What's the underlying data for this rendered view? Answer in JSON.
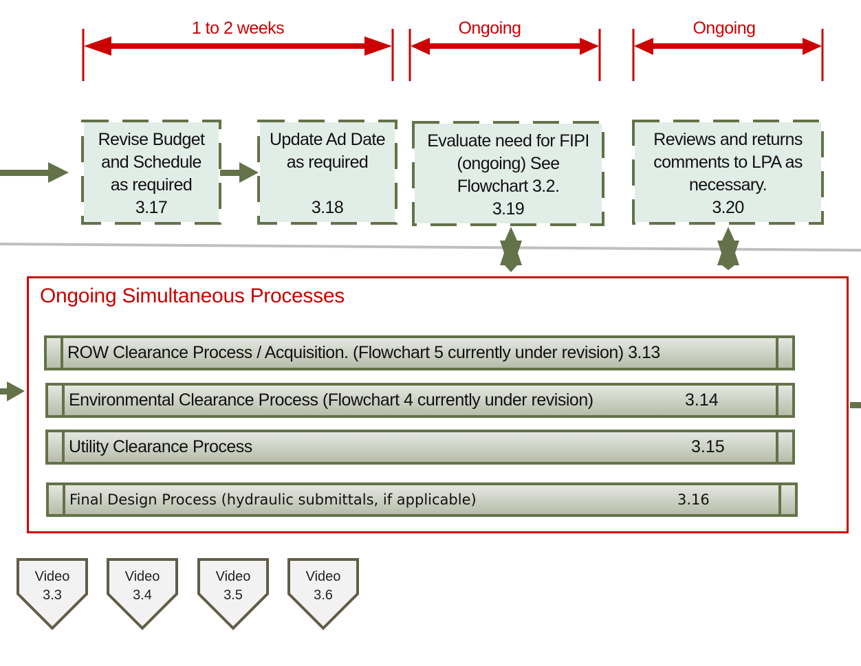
{
  "colors": {
    "duration_red": "#cc0000",
    "flow_green": "#637248",
    "step_fill": "#e1ede7",
    "divider_gray": "#bfbfbf",
    "video_border": "#625d48",
    "video_fill": "#f2f2f2"
  },
  "durations": [
    {
      "label": "1 to 2 weeks"
    },
    {
      "label": "Ongoing"
    },
    {
      "label": "Ongoing"
    }
  ],
  "steps": [
    {
      "lines": [
        "Revise Budget",
        "and Schedule",
        "as required"
      ],
      "number": "3.17"
    },
    {
      "lines": [
        "Update Ad Date",
        "as required",
        ""
      ],
      "number": "3.18"
    },
    {
      "lines": [
        "Evaluate need for FIPI",
        "(ongoing)  See",
        "Flowchart 3.2."
      ],
      "number": "3.19"
    },
    {
      "lines": [
        "Reviews and returns",
        "comments to LPA as",
        "necessary."
      ],
      "number": "3.20"
    }
  ],
  "ongoing": {
    "title": "Ongoing Simultaneous Processes",
    "processes": [
      {
        "label": "ROW Clearance Process / Acquisition. (Flowchart 5 currently under revision) 3.13",
        "ref": ""
      },
      {
        "label": "Environmental Clearance Process (Flowchart 4 currently under revision)",
        "ref": "3.14"
      },
      {
        "label": "Utility Clearance Process",
        "ref": "3.15"
      },
      {
        "label": "Final Design Process (hydraulic submittals, if applicable)",
        "ref": "3.16"
      }
    ]
  },
  "videos": [
    {
      "label": "Video",
      "number": "3.3"
    },
    {
      "label": "Video",
      "number": "3.4"
    },
    {
      "label": "Video",
      "number": "3.5"
    },
    {
      "label": "Video",
      "number": "3.6"
    }
  ],
  "icons": {
    "duration_arrow": "double-headed-arrow-icon",
    "flow_arrow": "right-arrow-icon",
    "connector": "six-point-star-connector-icon",
    "video": "video-badge-icon"
  }
}
